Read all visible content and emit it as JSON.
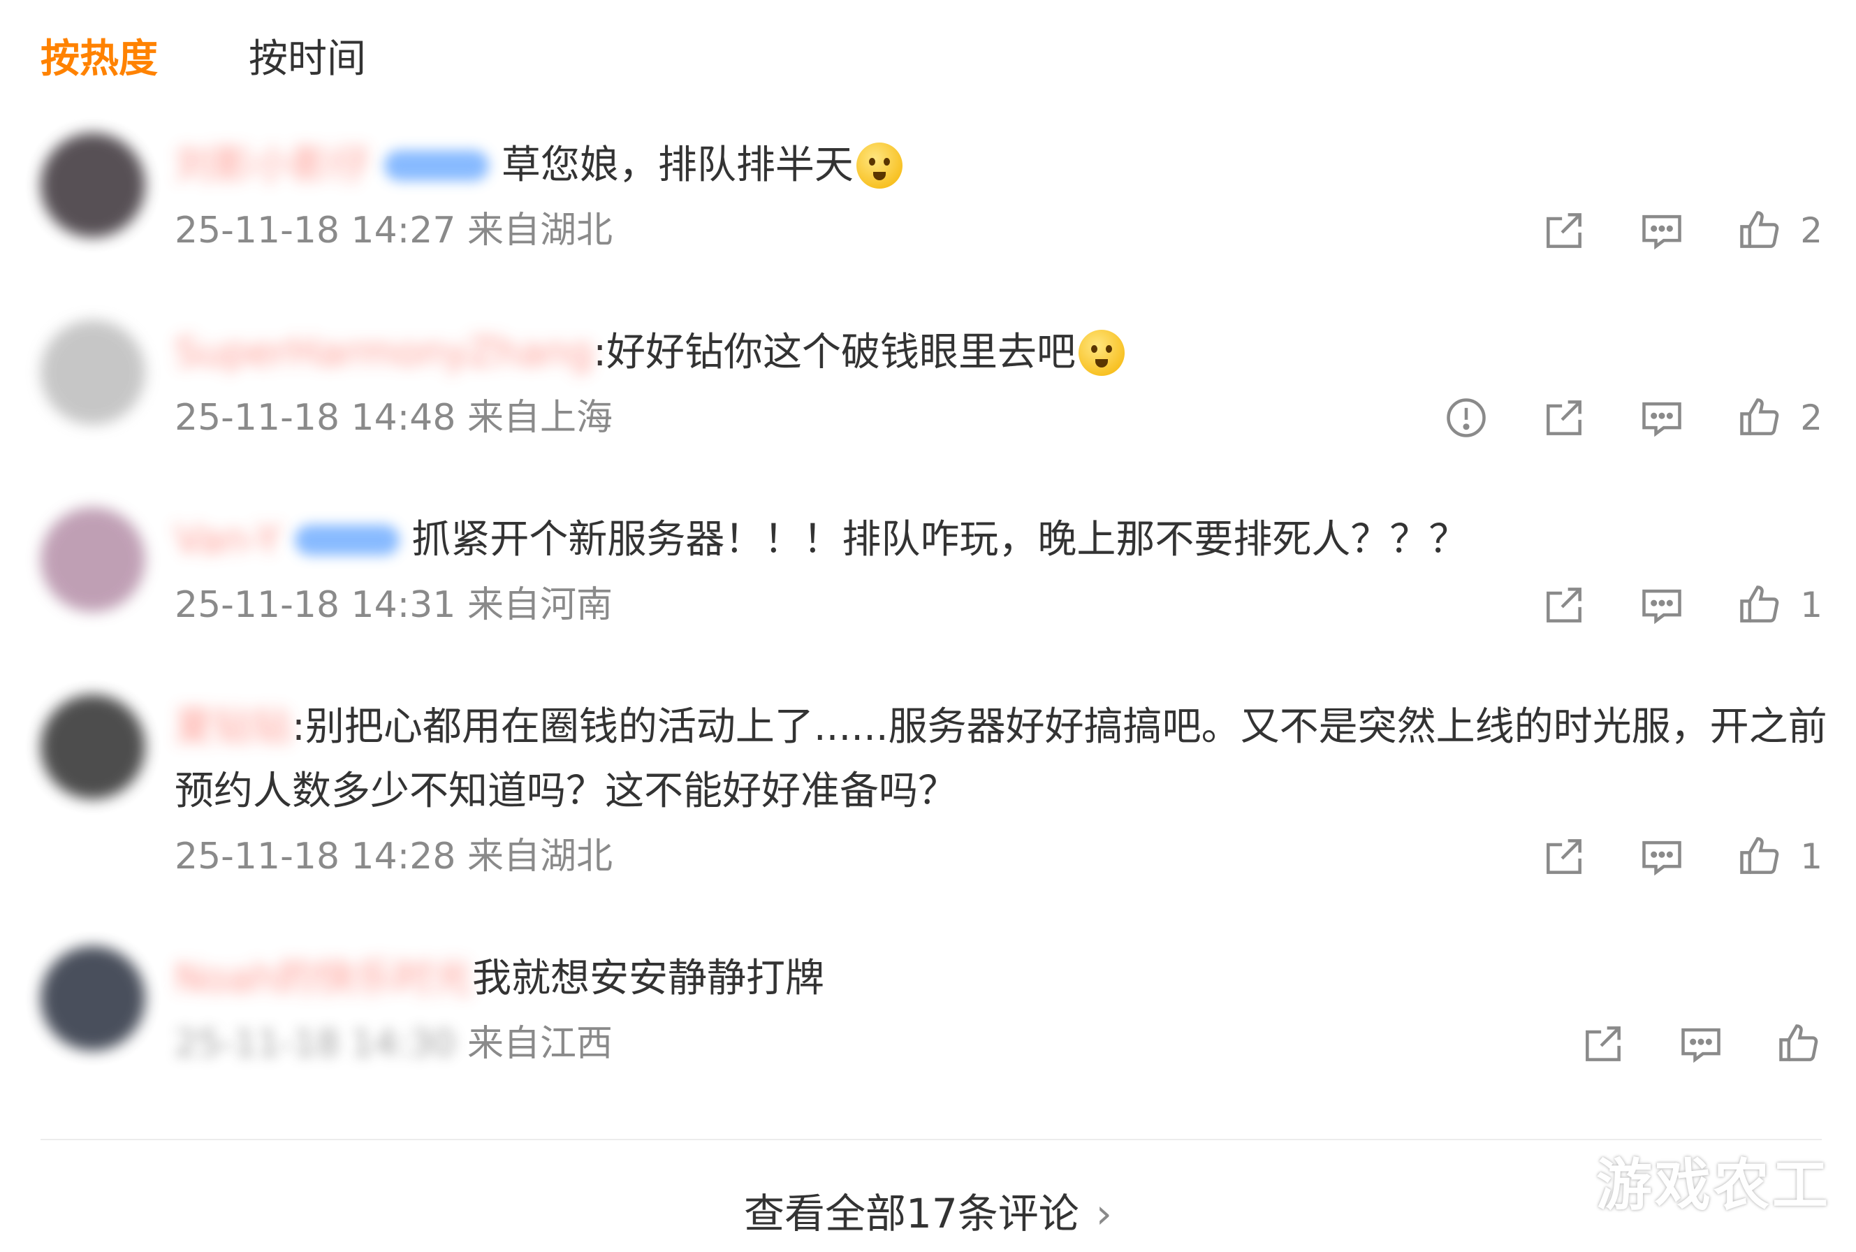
{
  "tabs": {
    "hot": "按热度",
    "time": "按时间"
  },
  "comments": [
    {
      "username": "刘影小影仔",
      "text": "草您娘，排队排半天",
      "time": "25-11-18 14:27",
      "location": "来自湖北",
      "likes": "2",
      "has_badge": true,
      "has_report": false,
      "emoji": "angry-emoji",
      "avatar_color": "#3a3238"
    },
    {
      "username": "SuperHarmonyZhang",
      "text": ":好好钻你这个破钱眼里去吧",
      "time": "25-11-18 14:48",
      "location": "来自上海",
      "likes": "2",
      "has_badge": false,
      "has_report": true,
      "emoji": "laughing-emoji",
      "avatar_color": "#bdbdbd"
    },
    {
      "username": "Van-Y",
      "text": "抓紧开个新服务器！！！排队咋玩，晚上那不要排死人？？？",
      "time": "25-11-18 14:31",
      "location": "来自河南",
      "likes": "1",
      "has_badge": true,
      "has_report": false,
      "emoji": "",
      "avatar_color": "#b58fa8"
    },
    {
      "username": "夏钻钻",
      "text_line1": ":别把心都用在圈钱的活动上了......服务器好好搞搞吧。又不是突然上线的时光服，开之前",
      "text_line2": "预约人数多少不知道吗？这不能好好准备吗？",
      "time": "25-11-18 14:28",
      "location": "来自湖北",
      "likes": "1",
      "has_badge": false,
      "has_report": false,
      "emoji": "",
      "avatar_color": "#2e2e2e"
    },
    {
      "username": "Noah的快乐时光",
      "text": "我就想安安静静打牌",
      "time": "25-11-18 14:30",
      "location": "来自江西",
      "likes": "",
      "has_badge": false,
      "has_report": false,
      "emoji": "",
      "avatar_color": "#2a3140"
    }
  ],
  "footer": {
    "view_all": "查看全部17条评论",
    "chevron": "›"
  },
  "watermark": "游戏农工",
  "colors": {
    "accent": "#ff8200",
    "meta": "#8a8a8a",
    "text": "#333333"
  }
}
